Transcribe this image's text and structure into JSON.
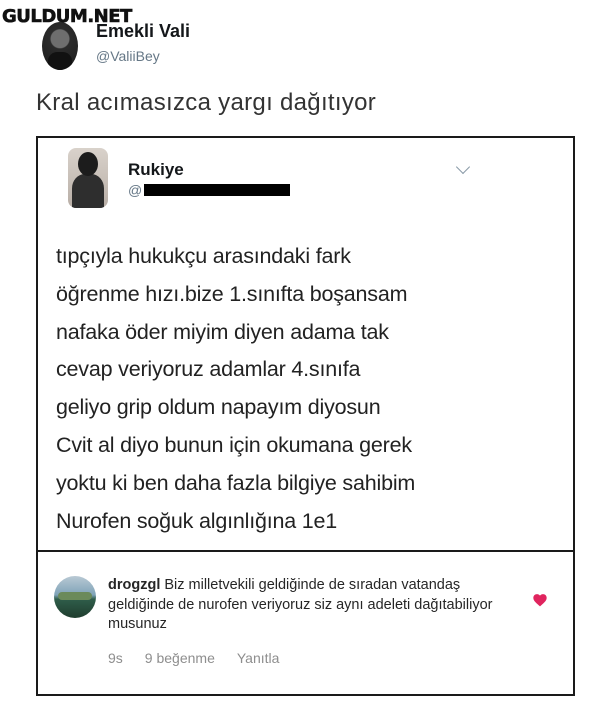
{
  "watermark": "GULDUM.NET",
  "tweet": {
    "display_name": "Emekli Vali",
    "handle": "@ValiiBey",
    "text": "Kral acımasızca yargı dağıtıyor"
  },
  "quoted": {
    "display_name": "Rukiye",
    "handle_prefix": "@",
    "lines": [
      "tıpçıyla hukukçu arasındaki fark",
      "öğrenme hızı.bize 1.sınıfta boşansam",
      "nafaka öder miyim diyen adama tak",
      "cevap veriyoruz adamlar 4.sınıfa",
      "geliyo grip oldum napayım diyosun",
      "Cvit al diyo bunun için okumana gerek",
      "yoktu ki ben daha fazla bilgiye sahibim",
      "Nurofen soğuk algınlığına 1e1"
    ]
  },
  "comment": {
    "username": "drogzgl",
    "text": "Biz milletvekili geldiğinde de sıradan vatandaş geldiğinde de nurofen veriyoruz siz aynı adeleti dağıtabiliyor musunuz",
    "time": "9s",
    "likes": "9 beğenme",
    "reply": "Yanıtla",
    "heart_color": "#e0245e"
  }
}
